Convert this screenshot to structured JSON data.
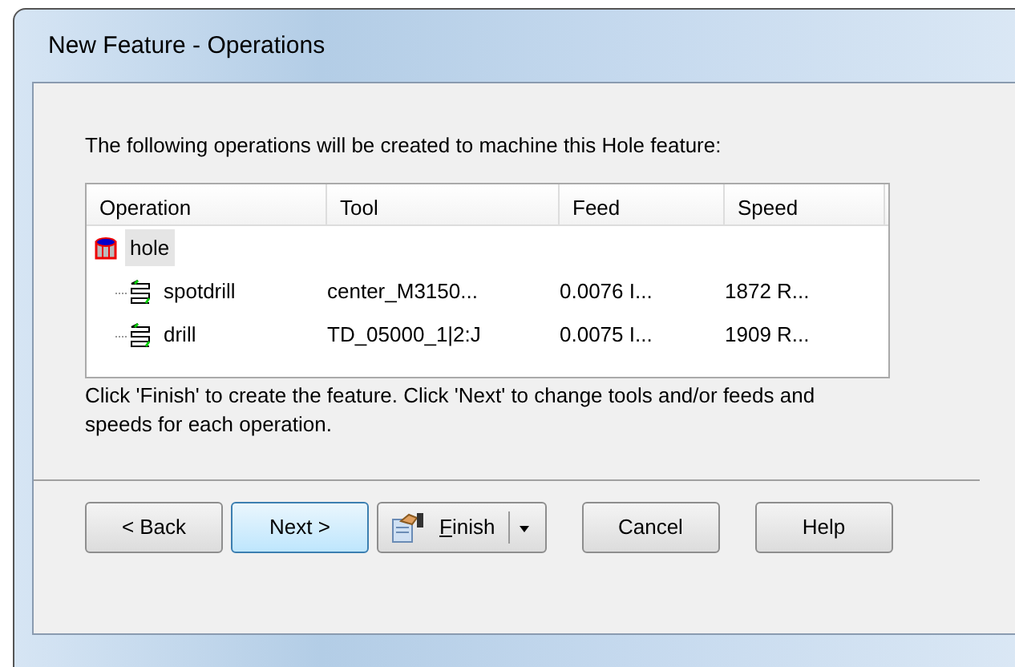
{
  "window": {
    "title": "New Feature - Operations"
  },
  "intro": "The following operations will be created to machine this Hole feature:",
  "table": {
    "columns": [
      "Operation",
      "Tool",
      "Feed",
      "Speed"
    ],
    "rows": [
      {
        "name": "hole",
        "kind": "feature",
        "selected": true,
        "cells": [],
        "children": [
          {
            "name": "spotdrill",
            "kind": "operation",
            "selected": false,
            "cells": [
              "center_M3150...",
              "0.0076 I...",
              "1872 R..."
            ]
          },
          {
            "name": "drill",
            "kind": "operation",
            "selected": false,
            "cells": [
              "TD_05000_1|2:J",
              "0.0075 I...",
              "1909 R..."
            ]
          }
        ]
      }
    ]
  },
  "hint": "Click 'Finish' to create the feature.  Click 'Next' to change tools and/or feeds and speeds for each operation.",
  "buttons": [
    {
      "label": "< Back",
      "kind": "plain",
      "default": false
    },
    {
      "label": "Next >",
      "kind": "plain",
      "default": true
    },
    {
      "label": "Finish",
      "kind": "split",
      "default": false
    },
    {
      "label": "Cancel",
      "kind": "plain",
      "default": false
    },
    {
      "label": "Help",
      "kind": "plain",
      "default": false
    }
  ]
}
